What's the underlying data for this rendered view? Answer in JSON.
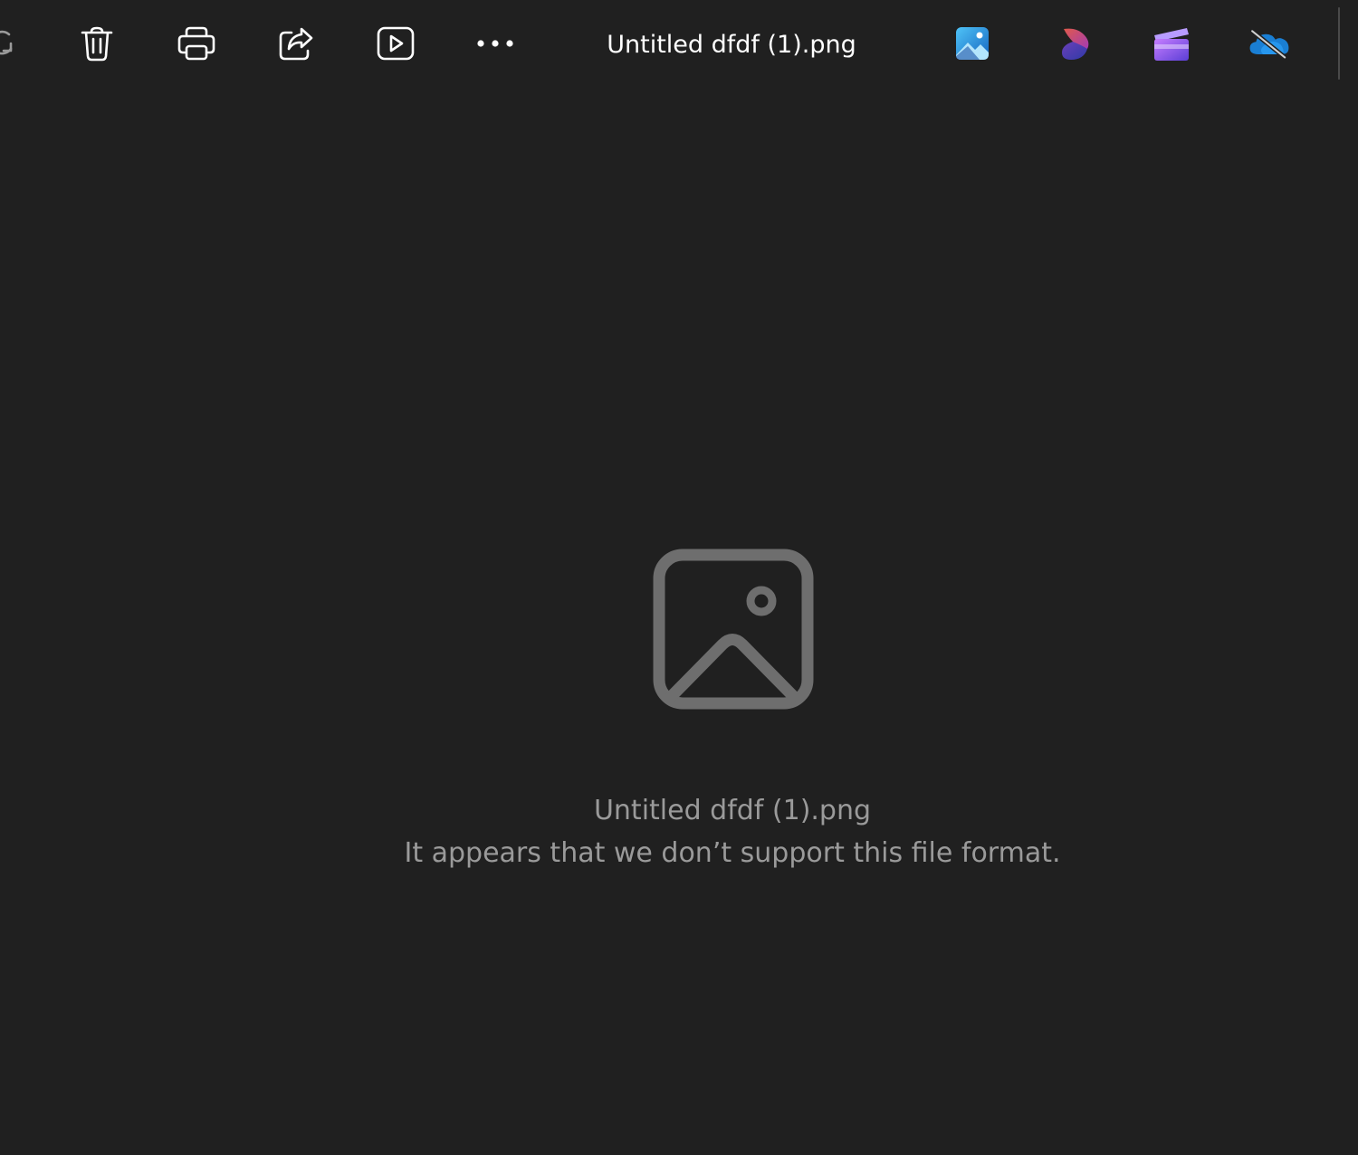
{
  "toolbar": {
    "title": "Untitled dfdf (1).png",
    "icon_color": "#ffffff",
    "buttons": [
      {
        "name": "rotate",
        "icon": "rotate-icon"
      },
      {
        "name": "delete",
        "icon": "trash-icon"
      },
      {
        "name": "print",
        "icon": "printer-icon"
      },
      {
        "name": "share",
        "icon": "share-icon"
      },
      {
        "name": "slideshow",
        "icon": "play-icon"
      },
      {
        "name": "more",
        "icon": "more-icon"
      }
    ],
    "apps": [
      {
        "name": "photos",
        "icon": "photos-app-icon",
        "color": "#1e90e0"
      },
      {
        "name": "designer",
        "icon": "designer-app-icon",
        "color": "#7a3fb0"
      },
      {
        "name": "clipchamp",
        "icon": "clipchamp-app-icon",
        "color": "#8a5cf0"
      },
      {
        "name": "onedrive",
        "icon": "onedrive-offline-icon",
        "color": "#1a7fd4"
      }
    ]
  },
  "main": {
    "placeholder_icon": "image-placeholder-icon",
    "file_name": "Untitled dfdf (1).png",
    "error_message": "It appears that we don’t support this file format.",
    "text_color": "#9a9a9a",
    "background": "#202020"
  }
}
